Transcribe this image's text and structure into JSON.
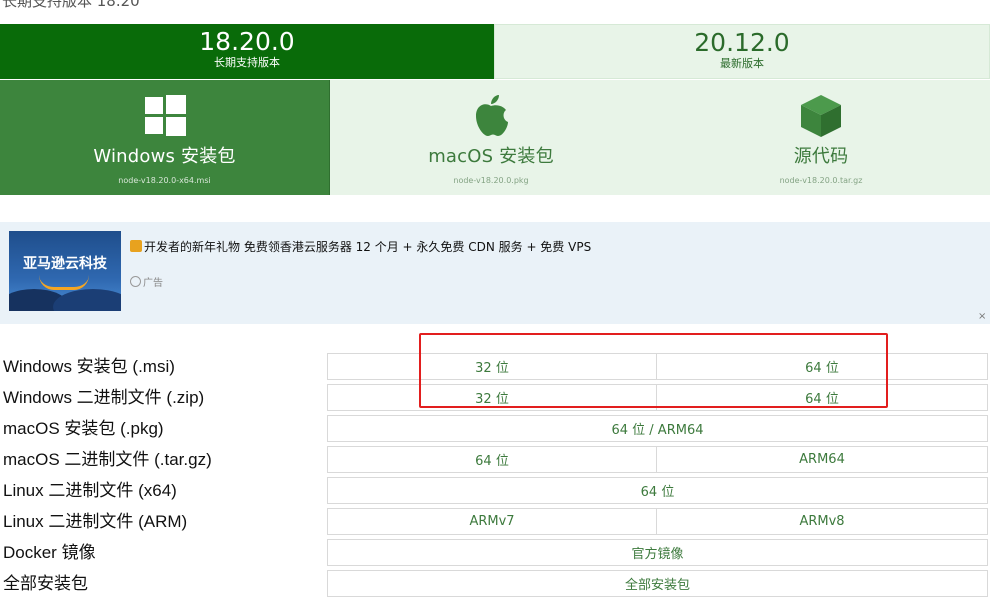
{
  "header": {
    "partial_text": "长期支持版本 18.20"
  },
  "version_tabs": [
    {
      "version": "18.20.0",
      "label": "长期支持版本"
    },
    {
      "version": "20.12.0",
      "label": "最新版本"
    }
  ],
  "package_tiles": [
    {
      "title": "Windows 安装包",
      "filename": "node-v18.20.0-x64.msi",
      "icon": "windows-logo"
    },
    {
      "title": "macOS 安装包",
      "filename": "node-v18.20.0.pkg",
      "icon": "apple-logo"
    },
    {
      "title": "源代码",
      "filename": "node-v18.20.0.tar.gz",
      "icon": "box-icon"
    }
  ],
  "ad": {
    "image_text": "亚马逊云科技",
    "line": "开发者的新年礼物 免费领香港云服务器 12 个月 + 永久免费 CDN 服务 + 免费 VPS",
    "tag": "广告",
    "close": "×"
  },
  "downloads": [
    {
      "label": "Windows 安装包 (.msi)",
      "links": [
        "32 位",
        "64 位"
      ]
    },
    {
      "label": "Windows 二进制文件 (.zip)",
      "links": [
        "32 位",
        "64 位"
      ]
    },
    {
      "label": "macOS 安装包 (.pkg)",
      "links": [
        "64 位 / ARM64"
      ]
    },
    {
      "label": "macOS 二进制文件 (.tar.gz)",
      "links": [
        "64 位",
        "ARM64"
      ]
    },
    {
      "label": "Linux 二进制文件 (x64)",
      "links": [
        "64 位"
      ]
    },
    {
      "label": "Linux 二进制文件 (ARM)",
      "links": [
        "ARMv7",
        "ARMv8"
      ]
    },
    {
      "label": "Docker 镜像",
      "links": [
        "官方镜像"
      ]
    },
    {
      "label": "全部安装包",
      "links": [
        "全部安装包"
      ]
    }
  ],
  "colors": {
    "lts_bg": "#096b09",
    "tile_active_bg": "#3d853d",
    "tile_bg": "#e8f4e8",
    "link_green": "#3d7a3d",
    "highlight_red": "#e21e1e"
  }
}
